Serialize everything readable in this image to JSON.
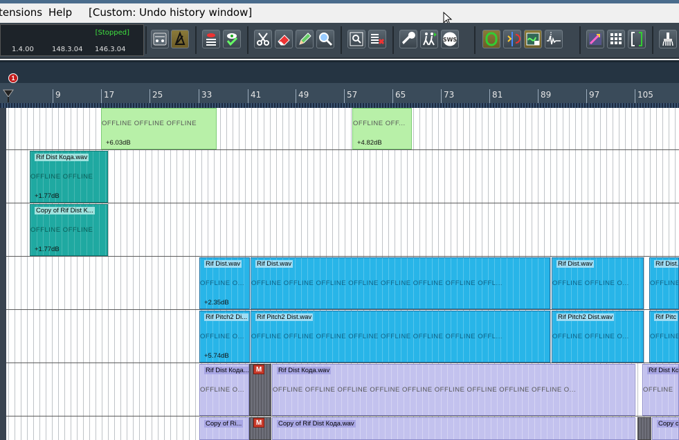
{
  "menu": {
    "extensions": "tensions",
    "help": "Help",
    "custom_action": "[Custom: Undo history window]"
  },
  "transport": {
    "status": "[Stopped]",
    "time_values": [
      "1.4.00",
      "148.3.04",
      "146.3.04"
    ]
  },
  "toolbar": {
    "icons": [
      "metronome-icon",
      "grid-snap-icon",
      "eye-red-icon",
      "eye-check-icon",
      "scissors-icon",
      "eraser-icon",
      "pencil-icon",
      "zoom-icon",
      "magnify-icon",
      "delete-track-icon",
      "wrench-icon",
      "walkers-icon",
      "sws-icon",
      "loop-icon",
      "split-icon",
      "ripple-icon",
      "envelope-icon",
      "color-icon",
      "grid-icon",
      "bracket-icon",
      "brush-icon"
    ],
    "sws_label": "SWS"
  },
  "marker": {
    "label": "1"
  },
  "ruler": {
    "labels": [
      "9",
      "17",
      "25",
      "33",
      "41",
      "49",
      "57",
      "65",
      "73",
      "81",
      "89",
      "97",
      "105"
    ]
  },
  "lanes": {
    "lane1": {
      "items": [
        {
          "offline": "OFFLINE      OFFLINE      OFFLINE",
          "vol": "+6.03dB"
        },
        {
          "offline": "OFFLINE      OFF...",
          "vol": "+4.82dB"
        }
      ]
    },
    "lane2": {
      "items": [
        {
          "name": "Rif Dist Кода.wav",
          "offline": "OFFLINE      OFFLINE",
          "vol": "+1.77dB"
        }
      ]
    },
    "lane3": {
      "items": [
        {
          "name": "Copy of    Rif Dist K...",
          "offline": "OFFLINE      OFFLINE",
          "vol": "+1.77dB"
        }
      ]
    },
    "lane4": {
      "items": [
        {
          "name": "Rif Dist.wav",
          "offline": "OFFLINE    O...",
          "vol": "+2.35dB"
        },
        {
          "name": "Rif Dist.wav",
          "offline": "OFFLINE     OFFLINE     OFFLINE     OFFLINE     OFFLINE     OFFLINE     OFFLINE     OFFL..."
        },
        {
          "name": "Rif Dist.wav",
          "offline": "OFFLINE     OFFLINE     O..."
        },
        {
          "name": "Rif Dist.",
          "offline": "OFFLINE"
        }
      ]
    },
    "lane5": {
      "items": [
        {
          "name": "Rif Pitch2 Di...",
          "offline": "OFFLINE    O...",
          "vol": "+5.74dB"
        },
        {
          "name": "Rif Pitch2 Dist.wav",
          "offline": "OFFLINE     OFFLINE     OFFLINE     OFFLINE     OFFLINE     OFFLINE     OFFLINE     OFFL..."
        },
        {
          "name": "Rif Pitch2 Dist.wav",
          "offline": "OFFLINE     OFFLINE     O..."
        },
        {
          "name": "Rif Pitc",
          "offline": "OFFLINE"
        }
      ]
    },
    "lane6": {
      "items": [
        {
          "name": "Rif Dist Кода...",
          "offline": "OFFLINE    O..."
        },
        {
          "name": "Rif Dist Кода.wav",
          "offline": "OFFLINE     OFFLINE     OFFLINE     OFFLINE     OFFLINE     OFFLINE     OFFLINE     OFFLINE     OFFLINE     O..."
        },
        {
          "name": "Rif Dist Кода",
          "offline": "OFFLINE"
        }
      ],
      "mute": "M"
    },
    "lane7": {
      "items": [
        {
          "name": "Copy of    Ri..."
        },
        {
          "name": "Copy of    Rif Dist Кода.wav"
        },
        {
          "name": "Copy o"
        }
      ],
      "mute": "M"
    }
  },
  "colors": {
    "toolbar_bg": "#3b4650",
    "ruler_bg": "#3a4b5a",
    "green_item": "#b8f0a8",
    "teal_item": "#1fa9a1",
    "blue_item": "#28b5e8",
    "purple_item": "#c3c2ee",
    "mute_red": "#c83a2a",
    "stopped_green": "#3fe23f"
  }
}
